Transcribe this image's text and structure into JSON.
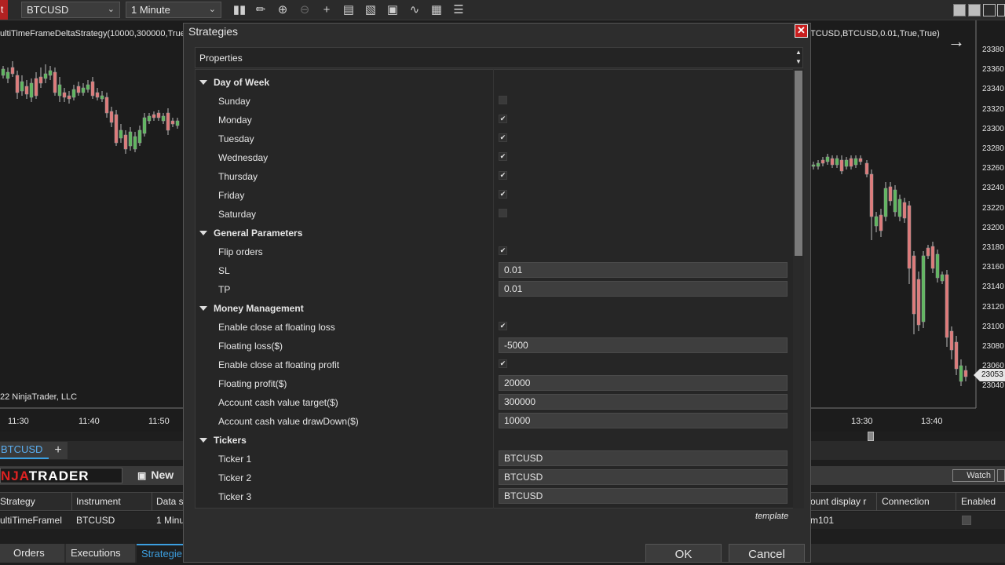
{
  "toolbar": {
    "app_badge": "t",
    "instrument": "BTCUSD",
    "interval": "1 Minute",
    "icons": [
      "bar-type-icon",
      "draw-icon",
      "zoom-in-icon",
      "zoom-out-icon",
      "crosshair-icon",
      "data-box-icon",
      "show-tabs-icon",
      "properties-icon",
      "indicators-icon",
      "strategies-icon",
      "templates-icon"
    ]
  },
  "chart": {
    "strategy_label_left": "ultiTimeFrameDeltaStrategy(10000,300000,True,",
    "strategy_label_right": "TCUSD,BTCUSD,0.01,True,True)",
    "copyright": "22 NinjaTrader, LLC",
    "x_ticks": [
      "11:30",
      "11:40",
      "11:50",
      "13:30",
      "13:40"
    ],
    "y_ticks": [
      "23380",
      "23360",
      "23340",
      "23320",
      "23300",
      "23280",
      "23260",
      "23240",
      "23220",
      "23200",
      "23180",
      "23160",
      "23140",
      "23120",
      "23100",
      "23080",
      "23060",
      "23040"
    ],
    "last_price": "23053",
    "up_color": "#5fb85f",
    "down_color": "#e07a7a"
  },
  "tabs": {
    "active": "BTCUSD",
    "add": "+"
  },
  "control_center": {
    "logo_part1": "NJA",
    "logo_part2": "TRADER",
    "new_label": "New",
    "watch_label": "Watch",
    "columns": [
      "Strategy",
      "Instrument",
      "Data s",
      "ount display r",
      "Connection",
      "Enabled"
    ],
    "row": {
      "strategy": "ultiTimeFramel",
      "instrument": "BTCUSD",
      "data": "1 Minu",
      "account": "m101"
    },
    "bottom_tabs": [
      "Orders",
      "Executions",
      "Strategie"
    ]
  },
  "dialog": {
    "title": "Strategies",
    "close": "✕",
    "properties_title": "Properties",
    "template_label": "template",
    "ok_label": "OK",
    "cancel_label": "Cancel",
    "categories": {
      "day_of_week": "Day of Week",
      "general": "General Parameters",
      "money": "Money Management",
      "tickers": "Tickers"
    },
    "props": {
      "sunday": {
        "label": "Sunday",
        "checked": false
      },
      "monday": {
        "label": "Monday",
        "checked": true
      },
      "tuesday": {
        "label": "Tuesday",
        "checked": true
      },
      "wednesday": {
        "label": "Wednesday",
        "checked": true
      },
      "thursday": {
        "label": "Thursday",
        "checked": true
      },
      "friday": {
        "label": "Friday",
        "checked": true
      },
      "saturday": {
        "label": "Saturday",
        "checked": false
      },
      "flip_orders": {
        "label": "Flip orders",
        "checked": true
      },
      "sl": {
        "label": "SL",
        "value": "0.01"
      },
      "tp": {
        "label": "TP",
        "value": "0.01"
      },
      "enable_close_loss": {
        "label": "Enable close at floating loss",
        "checked": true
      },
      "floating_loss": {
        "label": "Floating loss($)",
        "value": "-5000"
      },
      "enable_close_profit": {
        "label": "Enable close at floating profit",
        "checked": true
      },
      "floating_profit": {
        "label": "Floating profit($)",
        "value": "20000"
      },
      "cash_target": {
        "label": "Account cash value target($)",
        "value": "300000"
      },
      "cash_drawdown": {
        "label": "Account cash value drawDown($)",
        "value": "10000"
      },
      "ticker1": {
        "label": "Ticker 1",
        "value": "BTCUSD"
      },
      "ticker2": {
        "label": "Ticker 2",
        "value": "BTCUSD"
      },
      "ticker3": {
        "label": "Ticker 3",
        "value": "BTCUSD"
      }
    }
  }
}
